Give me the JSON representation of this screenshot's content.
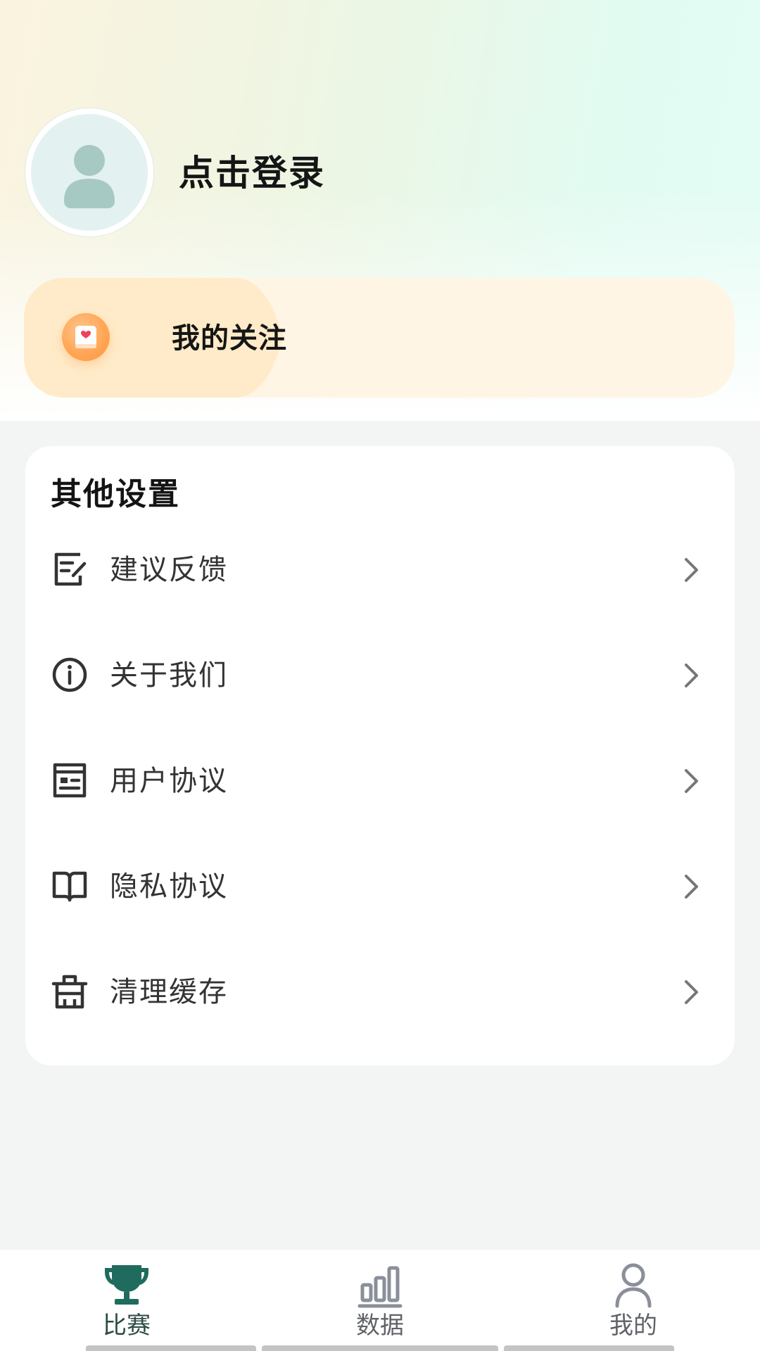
{
  "header": {
    "login_text": "点击登录"
  },
  "follow": {
    "label": "我的关注"
  },
  "settings": {
    "title": "其他设置",
    "items": [
      {
        "label": "建议反馈",
        "icon": "feedback-edit-icon"
      },
      {
        "label": "关于我们",
        "icon": "info-icon"
      },
      {
        "label": "用户协议",
        "icon": "document-icon"
      },
      {
        "label": "隐私协议",
        "icon": "book-icon"
      },
      {
        "label": "清理缓存",
        "icon": "basket-icon"
      }
    ]
  },
  "nav": {
    "items": [
      {
        "label": "比赛",
        "icon": "trophy-icon",
        "active": true
      },
      {
        "label": "数据",
        "icon": "bar-chart-icon",
        "active": false
      },
      {
        "label": "我的",
        "icon": "person-icon",
        "active": false
      }
    ]
  },
  "colors": {
    "active_nav": "#1f6b5e",
    "inactive_nav": "#8a8f99",
    "follow_card_bg": "#fff5e4",
    "follow_icon": "#ffa553"
  }
}
